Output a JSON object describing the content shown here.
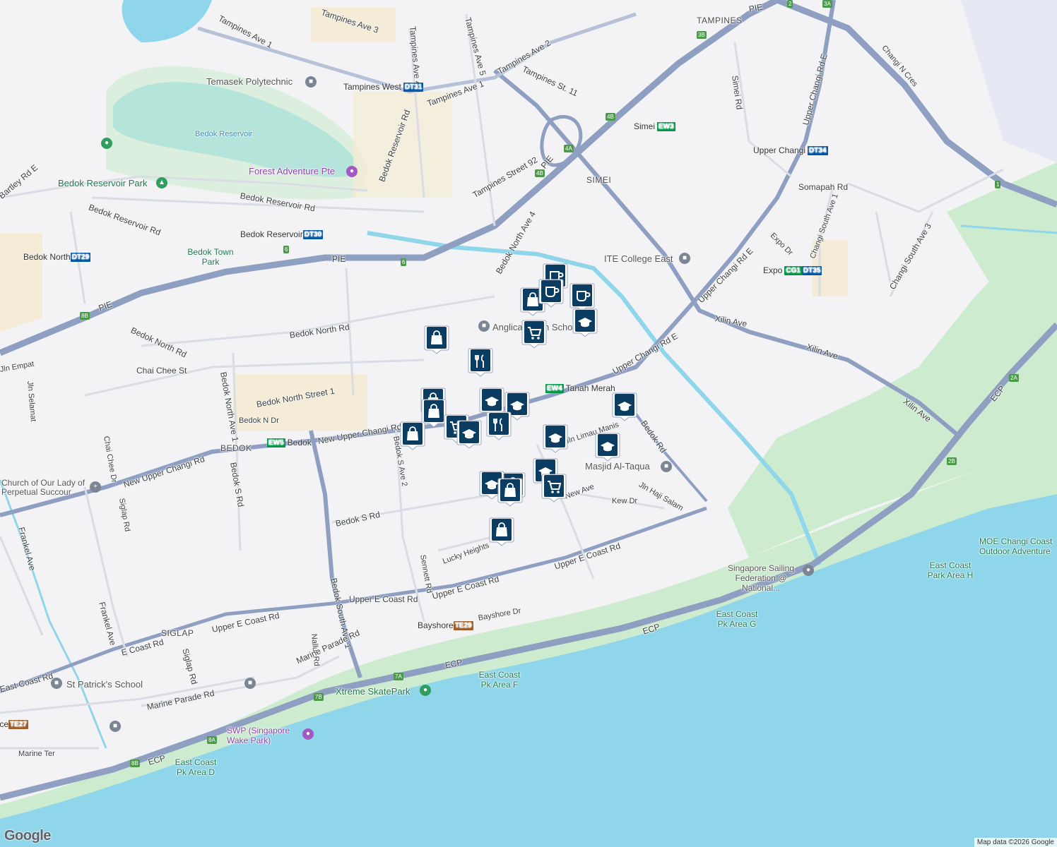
{
  "map": {
    "attribution": "Map data ©2026 Google",
    "logo": "Google",
    "colors": {
      "water": "#8fd6ea",
      "park": "#cdeccf",
      "road": "#8e9fc2",
      "land": "#f3f3f5",
      "marker": "#0b3d62",
      "markerBorder": "#ffffff"
    }
  },
  "areas": [
    {
      "id": "tampines",
      "label": "TAMPINES"
    },
    {
      "id": "simei",
      "label": "SIMEI"
    },
    {
      "id": "bedok",
      "label": "BEDOK"
    },
    {
      "id": "siglap",
      "label": "SIGLAP"
    }
  ],
  "roads": [
    "Tampines Ave 3",
    "Tampines Ave 1",
    "Tampines Ave 4",
    "Tampines Ave 5",
    "Tampines Ave 2",
    "Tampines St. 11",
    "Tampines Ave 1",
    "Bedok Reservoir Rd",
    "Tampines Street 92",
    "Bedok North Ave 4",
    "Bedok Reservoir Rd",
    "Bedok Reservoir Rd",
    "PIE",
    "PIE",
    "PIE",
    "PIE",
    "Bedok North Rd",
    "Bedok North Rd",
    "Chai Chee St",
    "Bedok North Street 1",
    "Bedok N Dr",
    "Bedok North Ave 1",
    "New Upper Changi Rd",
    "New Upper Changi Rd",
    "Bedok S Ave 2",
    "Bedok S Rd",
    "Bedok S Rd",
    "Chai Chee Dr",
    "Siglap Rd",
    "Frankel Ave",
    "Frankel Ave",
    "Bedok South Ave 1",
    "Sennett Rd",
    "Lucky Heights",
    "Upper E Coast Rd",
    "Upper E Coast Rd",
    "Upper E Coast Rd",
    "Upper E Coast Rd",
    "Bayshore Dr",
    "Nallur Rd",
    "E Coast Rd",
    "East Coast Rd",
    "Siglap Rd",
    "Marine Parade Rd",
    "Marine Parade Rd",
    "Marine Ter",
    "ECP",
    "ECP",
    "ECP",
    "ECP",
    "Upper Changi Rd E",
    "Upper Changi Rd E",
    "Upper Changi Rd E",
    "Bedok Rd",
    "Jln Haji Salam",
    "Kew Dr",
    "New Ave",
    "Jln Limau Manis",
    "Xilin Ave",
    "Xilin Ave",
    "Xilin Ave",
    "Simei Rd",
    "Somapah Rd",
    "Expo Dr",
    "Changi South Ave 1",
    "Changi South Ave 3",
    "Changi N Cres",
    "Jln Selamat",
    "Jln Empat",
    "Bartley Rd E"
  ],
  "stations": [
    {
      "name": "Tampines West",
      "code": "DT31",
      "color": "#0055a5"
    },
    {
      "name": "Simei",
      "code": "EW3",
      "color": "#009645"
    },
    {
      "name": "Upper Changi",
      "code": "DT34",
      "color": "#0055a5"
    },
    {
      "name": "Expo",
      "code": "CG1",
      "color": "#009645",
      "code2": "DT35",
      "color2": "#0055a5"
    },
    {
      "name": "Bedok Reservoir",
      "code": "DT30",
      "color": "#0055a5"
    },
    {
      "name": "Bedok North",
      "code": "DT29",
      "color": "#0055a5"
    },
    {
      "name": "Bedok",
      "code": "EW5",
      "color": "#009645"
    },
    {
      "name": "Tanah Merah",
      "code": "EW4",
      "color": "#009645"
    },
    {
      "name": "Bayshore",
      "code": "TE29",
      "color": "#9d5b25"
    },
    {
      "name": "Terrace",
      "code": "TE27",
      "color": "#9d5b25"
    }
  ],
  "places": [
    {
      "name": "Temasek Polytechnic",
      "icon": "school-icon"
    },
    {
      "name": "Bedok Reservoir",
      "icon": ""
    },
    {
      "name": "Forest Adventure Pte",
      "icon": "camera-icon"
    },
    {
      "name": "Bedok Reservoir Park",
      "icon": "tree-icon"
    },
    {
      "name": "Bedok Town Park",
      "icon": ""
    },
    {
      "name": "ITE College East",
      "icon": "school-icon"
    },
    {
      "name": "Anglican High School",
      "icon": "school-icon"
    },
    {
      "name": "Masjid Al-Taqua",
      "icon": "landmark-icon"
    },
    {
      "name": "Church of Our Lady of Perpetual Succour",
      "icon": "cross-icon"
    },
    {
      "name": "St Patrick's School",
      "icon": "school-icon"
    },
    {
      "name": "Xtreme SkatePark",
      "icon": "park-icon"
    },
    {
      "name": "SWP (Singapore Wake Park)",
      "icon": "camera-icon"
    },
    {
      "name": "East Coast Pk Area D",
      "icon": ""
    },
    {
      "name": "East Coast Pk Area F",
      "icon": ""
    },
    {
      "name": "East Coast Pk Area G",
      "icon": ""
    },
    {
      "name": "East Coast Park Area H",
      "icon": ""
    },
    {
      "name": "Singapore Sailing Federation @ National...",
      "icon": "pin-icon"
    },
    {
      "name": "MOE Changi Coast Outdoor Adventure",
      "icon": ""
    }
  ],
  "markers": [
    "cafe-marker",
    "shop-marker",
    "cafe-marker",
    "cafe-marker",
    "school-marker",
    "shop-marker",
    "grocery-marker",
    "shop-marker",
    "restaurant-marker",
    "school-marker",
    "school-marker",
    "school-marker",
    "shop-marker",
    "shop-marker",
    "grocery-marker",
    "school-marker",
    "restaurant-marker",
    "shop-marker",
    "school-marker",
    "school-marker",
    "school-marker",
    "school-marker",
    "shop-marker",
    "grocery-marker",
    "shop-marker"
  ],
  "expressway_shields": [
    "1",
    "2",
    "3A",
    "3B",
    "4A",
    "4B",
    "4B",
    "6",
    "6",
    "8B",
    "7A",
    "7B",
    "8A",
    "8B",
    "2A",
    "2B"
  ]
}
